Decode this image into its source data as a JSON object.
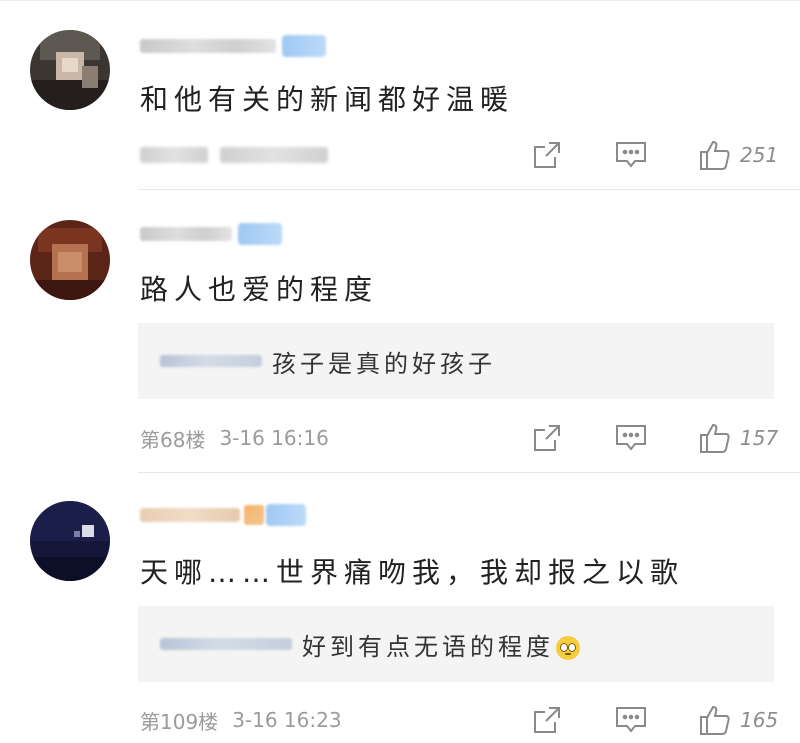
{
  "colors": {
    "icon_stroke": "#8a8a8a",
    "reply_bg": "#f4f4f4",
    "divider": "#e6e6e6",
    "name_badge": "#a9cff6"
  },
  "comments": [
    {
      "text": "和他有关的新闻都好温暖",
      "meta_floor": "",
      "meta_time": "",
      "likes": "251",
      "icons": {
        "share": "share-icon",
        "reply": "reply-icon",
        "like": "like-icon"
      }
    },
    {
      "text": "路人也爱的程度",
      "reply": {
        "text": "孩子是真的好孩子"
      },
      "meta_floor": "第68楼",
      "meta_time": "3-16 16:16",
      "likes": "157",
      "icons": {
        "share": "share-icon",
        "reply": "reply-icon",
        "like": "like-icon"
      }
    },
    {
      "text": "天哪……世界痛吻我，我却报之以歌",
      "reply": {
        "text": "好到有点无语的程度",
        "emoji": "rolling-eyes-emoji"
      },
      "meta_floor": "第109楼",
      "meta_time": "3-16 16:23",
      "likes": "165",
      "icons": {
        "share": "share-icon",
        "reply": "reply-icon",
        "like": "like-icon"
      }
    }
  ]
}
